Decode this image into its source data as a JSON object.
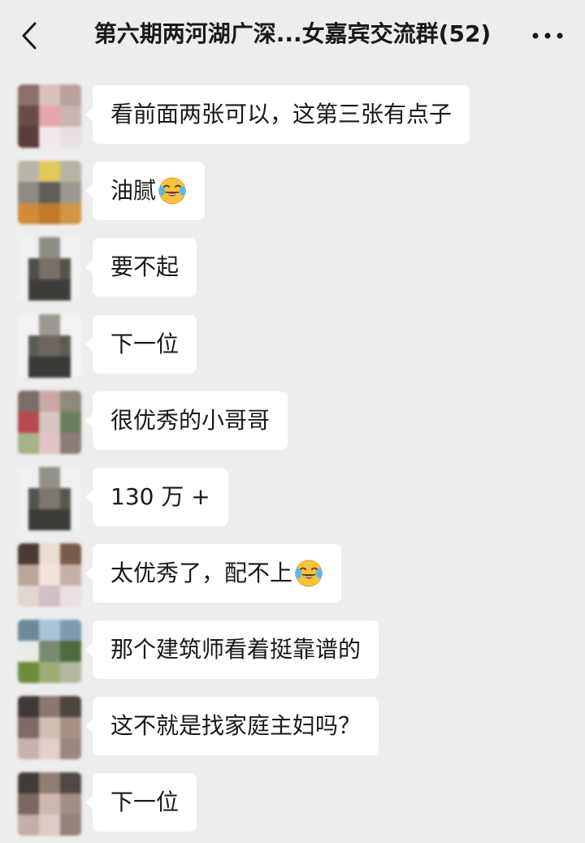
{
  "header": {
    "title": "第六期两河湖广深...女嘉宾交流群(52)",
    "back_icon": "chevron-left-icon",
    "more_icon": "more-dots-icon"
  },
  "messages": [
    {
      "text": "看前面两张可以，这第三张有点子",
      "emoji": null
    },
    {
      "text": "油腻",
      "emoji": "tears-of-joy-emoji"
    },
    {
      "text": "要不起",
      "emoji": null
    },
    {
      "text": "下一位",
      "emoji": null
    },
    {
      "text": "很优秀的小哥哥",
      "emoji": null
    },
    {
      "text": "130 万 +",
      "emoji": null
    },
    {
      "text": "太优秀了，配不上",
      "emoji": "tears-of-joy-emoji"
    },
    {
      "text": "那个建筑师看着挺靠谱的",
      "emoji": null
    },
    {
      "text": "这不就是找家庭主妇吗？",
      "emoji": null
    },
    {
      "text": "下一位",
      "emoji": null
    }
  ]
}
